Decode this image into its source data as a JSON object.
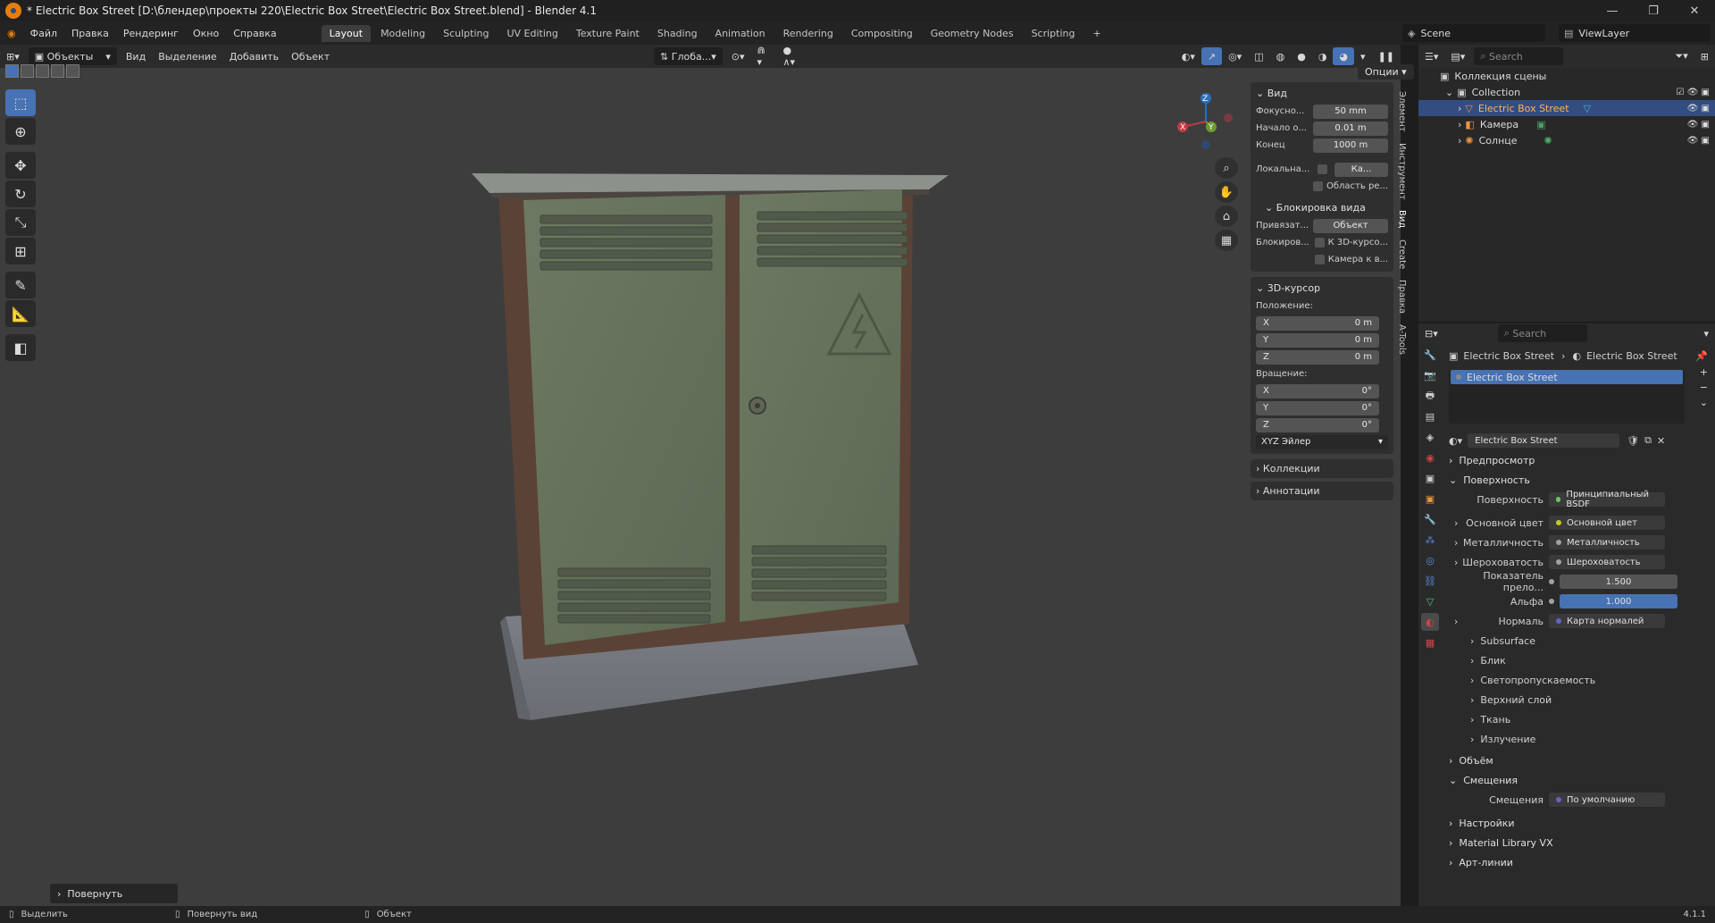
{
  "window": {
    "title": "* Electric Box Street [D:\\блендер\\проекты 220\\Electric Box Street\\Electric Box Street.blend] - Blender 4.1"
  },
  "menu": [
    "Файл",
    "Правка",
    "Рендеринг",
    "Окно",
    "Справка"
  ],
  "workspaces": [
    "Layout",
    "Modeling",
    "Sculpting",
    "UV Editing",
    "Texture Paint",
    "Shading",
    "Animation",
    "Rendering",
    "Compositing",
    "Geometry Nodes",
    "Scripting"
  ],
  "active_workspace": "Layout",
  "scene": "Scene",
  "view_layer": "ViewLayer",
  "viewport_header": {
    "mode": "Объекты",
    "menus": [
      "Вид",
      "Выделение",
      "Добавить",
      "Объект"
    ],
    "orientation": "Глоба...",
    "options": "Опции"
  },
  "npanel": {
    "view": {
      "title": "Вид",
      "focal_label": "Фокусно...",
      "focal_value": "50 mm",
      "clip_start_label": "Начало о...",
      "clip_start_value": "0.01 m",
      "clip_end_label": "Конец",
      "clip_end_value": "1000 m",
      "local_label": "Локальна...",
      "local_field": "Ка...",
      "render_region": "Область ре...",
      "lock_title": "Блокировка вида",
      "lock_to_label": "Привязат...",
      "lock_to_field": "Объект",
      "lock_label": "Блокиров...",
      "lock_cursor": "К 3D-курсо...",
      "lock_camera": "Камера к в..."
    },
    "cursor": {
      "title": "3D-курсор",
      "location_label": "Положение:",
      "x": "0 m",
      "y": "0 m",
      "z": "0 m",
      "rotation_label": "Вращение:",
      "rx": "0°",
      "ry": "0°",
      "rz": "0°",
      "rotation_mode": "XYZ Эйлер"
    },
    "collections": "Коллекции",
    "annotations": "Аннотации",
    "tabs": [
      "Элемент",
      "Инструмент",
      "Вид",
      "Create",
      "Правка",
      "A-Tools"
    ]
  },
  "axis_labels": {
    "x": "X",
    "y": "Y",
    "z": "Z"
  },
  "outliner": {
    "search_placeholder": "Search",
    "root": "Коллекция сцены",
    "collection": "Collection",
    "items": [
      "Electric Box Street",
      "Камера",
      "Солнце"
    ]
  },
  "properties": {
    "search_placeholder": "Search",
    "breadcrumb_object": "Electric Box Street",
    "breadcrumb_material": "Electric Box Street",
    "slot_name": "Electric Box Street",
    "material_name": "Electric Box Street",
    "sections": {
      "preview": "Предпросмотр",
      "surface": "Поверхность",
      "volume": "Объём",
      "displacement": "Смещения",
      "settings": "Настройки",
      "material_library": "Material Library VX",
      "lineart": "Арт-линии"
    },
    "surface_rows": [
      {
        "label": "Поверхность",
        "value": "Принципиальный BSDF",
        "dot": "#63c763"
      },
      {
        "label": "Основной цвет",
        "value": "Основной цвет",
        "dot": "#c7c729"
      },
      {
        "label": "Металличность",
        "value": "Металличность",
        "dot": "#a1a1a1"
      },
      {
        "label": "Шероховатость",
        "value": "Шероховатость",
        "dot": "#a1a1a1"
      },
      {
        "label": "Показатель прело...",
        "value": "1.500",
        "dot": "#a1a1a1"
      },
      {
        "label": "Альфа",
        "value": "1.000",
        "dot": "#a1a1a1"
      },
      {
        "label": "Нормаль",
        "value": "Карта нормалей",
        "dot": "#6363c7"
      }
    ],
    "subpanels": [
      "Subsurface",
      "Блик",
      "Светопропускаемость",
      "Верхний слой",
      "Ткань",
      "Излучение"
    ],
    "displacement_label": "Смещения",
    "displacement_value": "По умолчанию"
  },
  "last_operator": "Повернуть",
  "status": {
    "left": "Выделить",
    "middle": "Повернуть вид",
    "right": "Объект",
    "version": "4.1.1"
  }
}
